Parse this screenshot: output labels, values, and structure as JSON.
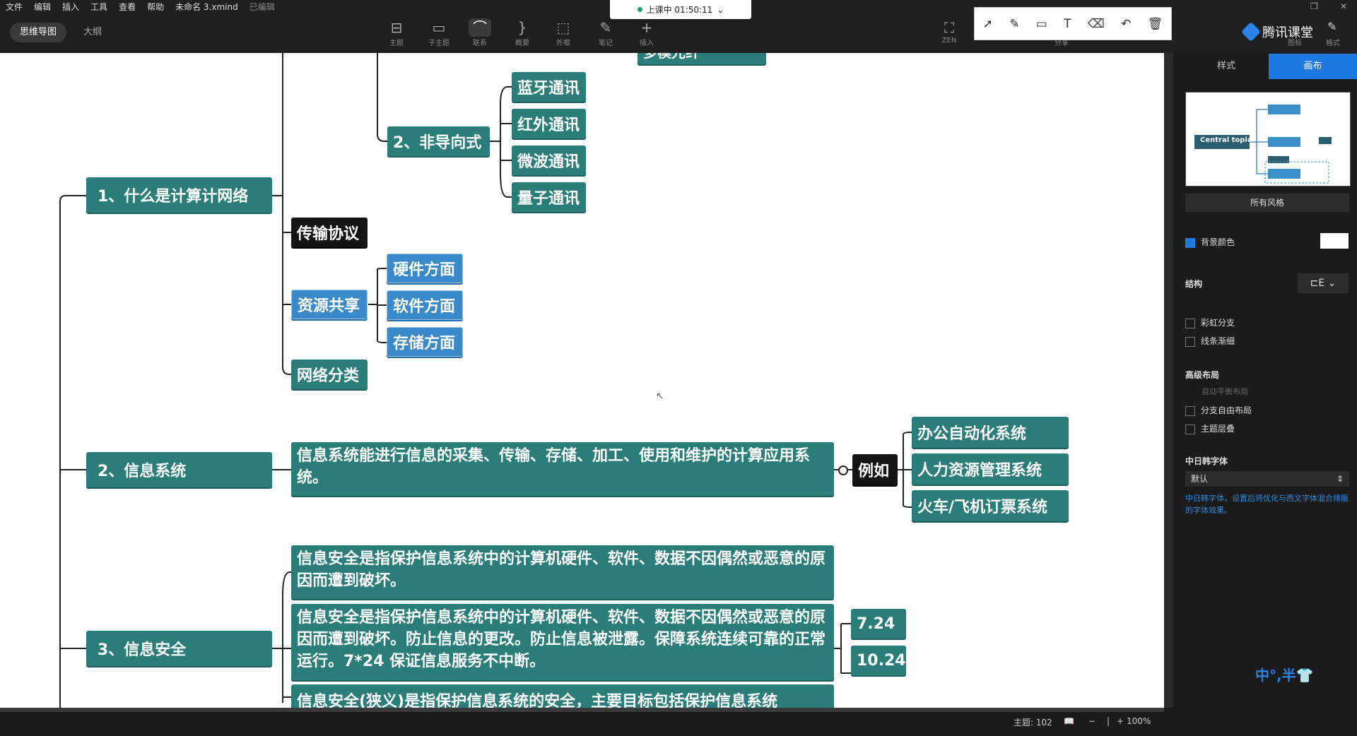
{
  "menu": {
    "items": [
      "文件",
      "编辑",
      "插入",
      "工具",
      "查看",
      "帮助"
    ],
    "filename": "未命名 3.xmind",
    "edited": "已编辑"
  },
  "view_tabs": {
    "mindmap": "思维导图",
    "outline": "大纲"
  },
  "toolbar": [
    {
      "icon": "subtopic-icon",
      "glyph": "⊟",
      "label": "主题"
    },
    {
      "icon": "child-topic-icon",
      "glyph": "▭",
      "label": "子主题"
    },
    {
      "icon": "relationship-icon",
      "glyph": "⌒",
      "label": "联系"
    },
    {
      "icon": "summary-icon",
      "glyph": "}",
      "label": "概要"
    },
    {
      "icon": "boundary-icon",
      "glyph": "⬚",
      "label": "外框"
    },
    {
      "icon": "note-icon",
      "glyph": "✎",
      "label": "笔记"
    },
    {
      "icon": "insert-icon",
      "glyph": "+",
      "label": "插入"
    }
  ],
  "zen_label": "ZEN",
  "share_label": "分享",
  "live": {
    "text": "上课中 01:50:11"
  },
  "brand": "腾讯课堂",
  "right_tabs": {
    "icon_label": "图标",
    "format_label": "格式"
  },
  "mindmap": {
    "partial_top": "多模光纤",
    "main1": "1、什么是计算计网络",
    "sub_non_guided": "2、非导向式",
    "comm": [
      "蓝牙通讯",
      "红外通讯",
      "微波通讯",
      "量子通讯"
    ],
    "protocol": "传输协议",
    "resource_share": "资源共享",
    "resource_items": [
      "硬件方面",
      "软件方面",
      "存储方面"
    ],
    "net_class": "网络分类",
    "main2": "2、信息系统",
    "info_sys_def": "信息系统能进行信息的采集、传输、存储、加工、使用和维护的计算应用系统。",
    "example": "例如",
    "examples": [
      "办公自动化系统",
      "人力资源管理系统",
      "火车/飞机订票系统"
    ],
    "main3": "3、信息安全",
    "sec_def1": "信息安全是指保护信息系统中的计算机硬件、软件、数据不因偶然或恶意的原因而遭到破坏。",
    "sec_def2": "信息安全是指保护信息系统中的计算机硬件、软件、数据不因偶然或恶意的原因而遭到破坏。防止信息的更改。防止信息被泄露。保障系统连续可靠的正常运行。7*24 保证信息服务不中断。",
    "dates": [
      "7.24",
      "10.24"
    ],
    "sec_def3": "信息安全(狭义)是指保护信息系统的安全，主要目标包括保护信息系统"
  },
  "panel": {
    "tab_style": "样式",
    "tab_canvas": "画布",
    "thumb_central": "Central topic",
    "all_styles": "所有风格",
    "bg_color": "背景颜色",
    "structure": "结构",
    "rainbow": "彩虹分支",
    "line_taper": "线条渐细",
    "advanced_layout": "高级布局",
    "auto_balance": "自动平衡布局",
    "free_layout": "分支自由布局",
    "topic_overlap": "主题层叠",
    "cjk_font": "中日韩字体",
    "font_value": "默认",
    "cjk_hint": "中日韩字体，设置后将优化与西文字体混合排版的字体效果。"
  },
  "ime": "中°,半👕",
  "status": {
    "topics": "主题: 102",
    "zoom": "100%"
  }
}
